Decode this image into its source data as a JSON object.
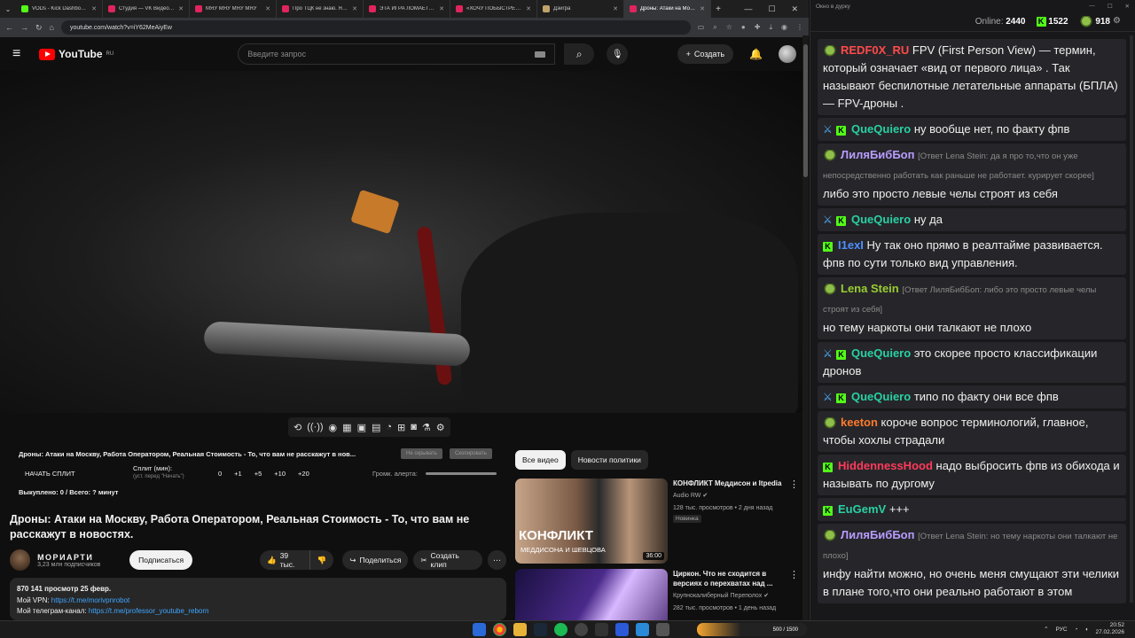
{
  "browser": {
    "tabs": [
      {
        "title": "VODs - Kick Dashboard",
        "color": "#53fc18"
      },
      {
        "title": "Студия — VK Видео Live",
        "color": "#e0245e"
      },
      {
        "title": "МЯУ МЯУ МЯУ МЯУ",
        "color": "#e0245e"
      },
      {
        "title": "Про ТЦК не знаю. Я ни...",
        "color": "#e0245e"
      },
      {
        "title": "ЭТА ИГРА ЛОМАЕТ ЛЮ...",
        "color": "#e0245e"
      },
      {
        "title": "«ХОЧУ ПОБЫСТРЕЕ ''С...",
        "color": "#e0245e"
      },
      {
        "title": "Дэйгра",
        "color": "#bfa36a"
      },
      {
        "title": "Дроны: Атаки на Моск...",
        "color": "#e0245e",
        "active": true
      }
    ],
    "url": "youtube.com/watch?v=iY62MeAiyEw"
  },
  "youtube": {
    "logo_text": "YouTube",
    "region": "RU",
    "search_placeholder": "Введите запрос",
    "create_label": "Создать",
    "splits": {
      "title": "Дроны: Атаки на Москву, Работа Оператором, Реальная Стоимость - То, что вам не расскажут в нов...",
      "btn_hide": "Не скрывать",
      "btn_copy": "Скопировать",
      "start_label": "НАЧАТЬ СПЛИТ",
      "split_label": "Сплит (мин):",
      "split_sub": "(уст. перед \"Начать\")",
      "values": [
        "0",
        "+1",
        "+5",
        "+10",
        "+20"
      ],
      "alert_label": "Громк. алерта:",
      "done_label": "Выкуплено: 0 / Всего: ? минут"
    },
    "video": {
      "title": "Дроны: Атаки на Москву, Работа Оператором, Реальная Стоимость - То, что вам не расскажут в новостях.",
      "channel": "МОРИАРТИ",
      "subscribers": "3,23 млн подписчиков",
      "subscribe_label": "Подписаться",
      "likes": "39 тыс.",
      "share_label": "Поделиться",
      "clip_label": "Создать клип",
      "desc_line1": "870 141 просмотр  25 февр.",
      "desc_vpn_label": "Мой VPN: ",
      "desc_vpn_link": "https://t.me/morivpnrobot",
      "desc_tg_label": "Мой телеграм-канал: ",
      "desc_tg_link": "https://t.me/professor_youtube_reborn"
    },
    "chips": [
      "Все видео",
      "Новости политики"
    ],
    "recs": [
      {
        "title": "КОНФЛИКТ Меддисон и Itpedia",
        "channel": "Audio RW",
        "meta": "128 тыс. просмотров • 2 дня назад",
        "badge": "Новинка",
        "duration": "36:00",
        "thumb_text": "КОНФЛИКТ",
        "thumb_sub": "МЕДДИСОНА И ШЕВЦОВА"
      },
      {
        "title": "Циркон. Что не сходится в версиях о перехватах над ...",
        "channel": "Крупнокалиберный Переполох",
        "meta": "282 тыс. просмотров • 1 день назад"
      }
    ]
  },
  "chat": {
    "window_title": "Окно в дурку",
    "online_label": "Online:",
    "online": "2440",
    "kick_count": "1522",
    "other_count": "918",
    "messages": [
      {
        "user": "REDF0X_RU",
        "color": "#ff4a4a",
        "badge": "pepe",
        "text": "FPV (First Person View) — термин, который означает «вид от первого лица» . Так называют беспилотные летательные аппараты (БПЛА) — FPV-дроны ."
      },
      {
        "user": "QueQuiero",
        "color": "#29d0a4",
        "badge": "kick",
        "text": "ну вообще нет, по факту фпв"
      },
      {
        "user": "ЛиляБибБоп",
        "color": "#b89cff",
        "badge": "pepe",
        "reply": "[Ответ Lena Stein: да я про то,что он уже непосредственно работать как раньше не работает. курирует скорее]",
        "text": "либо это просто левые челы строят из себя"
      },
      {
        "user": "QueQuiero",
        "color": "#29d0a4",
        "badge": "kick",
        "text": "ну да"
      },
      {
        "user": "I1exI",
        "color": "#4f8fff",
        "badge": "k-only",
        "text": "Ну так оно прямо в реалтайме развивается. фпв по сути только вид управления."
      },
      {
        "user": "Lena Stein",
        "color": "#9acd32",
        "badge": "pepe",
        "reply": "[Ответ ЛиляБибБоп: либо это просто левые челы строят из себя]",
        "text": "но тему наркоты они талкают не плохо"
      },
      {
        "user": "QueQuiero",
        "color": "#29d0a4",
        "badge": "kick",
        "text": "это скорее просто классификации дронов"
      },
      {
        "user": "QueQuiero",
        "color": "#29d0a4",
        "badge": "kick",
        "text": "типо по факту они все фпв"
      },
      {
        "user": "keeton",
        "color": "#ff7a2a",
        "badge": "pepe",
        "text": "короче вопрос терминологий, главное, чтобы хохлы страдали"
      },
      {
        "user": "HiddennessHood",
        "color": "#ff3a5a",
        "badge": "k-only",
        "text": "надо выбросить фпв из обихода и называть по дургому"
      },
      {
        "user": "EuGemV",
        "color": "#29d0a4",
        "badge": "k-only",
        "text": "+++"
      },
      {
        "user": "ЛиляБибБоп",
        "color": "#b89cff",
        "badge": "pepe",
        "reply": "[Ответ Lena Stein: но тему наркоты они талкают не плохо]",
        "text": "инфу найти можно, но очень меня смущают эти челики в плане того,что они реально работают в этом"
      }
    ]
  },
  "taskbar": {
    "widget_text": "500 / 1500",
    "lang": "РУС",
    "time": "20:52",
    "date": "27.02.2026"
  }
}
